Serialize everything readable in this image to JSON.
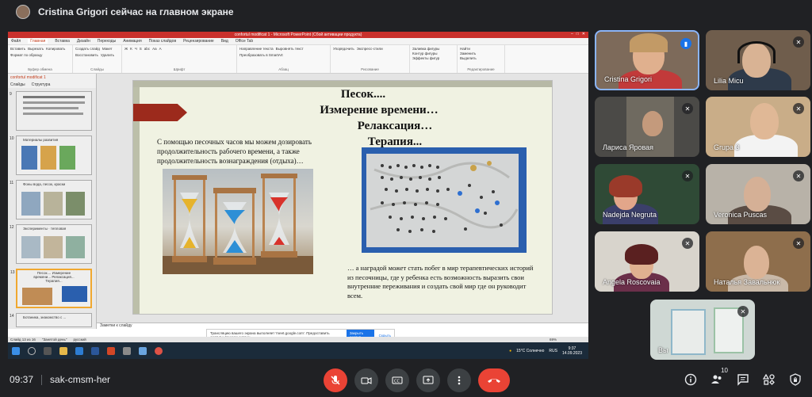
{
  "presenter": {
    "text": "Cristina Grigori сейчас на главном экране"
  },
  "ppt": {
    "window_title": "confortul modificat 1 - Microsoft PowerPoint (Сбой активации продукта)",
    "tabs": [
      "Файл",
      "Главная",
      "Вставка",
      "Дизайн",
      "Переходы",
      "Анимация",
      "Показ слайдов",
      "Рецензирование",
      "Вид",
      "Office Tab"
    ],
    "ribbon_groups": [
      {
        "label": "Буфер обмена",
        "items": [
          "Вставить",
          "Вырезать",
          "Копировать",
          "Формат по образцу"
        ]
      },
      {
        "label": "Слайды",
        "items": [
          "Создать слайд",
          "Макет",
          "Восстановить",
          "Удалить"
        ]
      },
      {
        "label": "Шрифт",
        "items": [
          "Ж",
          "К",
          "Ч",
          "S",
          "abc",
          "Аа",
          "A"
        ]
      },
      {
        "label": "Абзац",
        "items": [
          "Направление текста",
          "Выровнять текст",
          "Преобразовать в SmartArt"
        ]
      },
      {
        "label": "Рисование",
        "items": [
          "Упорядочить",
          "Экспресс-стили"
        ]
      },
      {
        "label": "",
        "items": [
          "Заливка фигуры",
          "Контур фигуры",
          "Эффекты фигур"
        ]
      },
      {
        "label": "Редактирование",
        "items": [
          "Найти",
          "Заменить",
          "Выделить"
        ]
      }
    ],
    "file_tab": "confortul modificat 1",
    "pane_tabs": [
      "Слайды",
      "Структура"
    ],
    "thumbnails": [
      {
        "num": "9",
        "title": ""
      },
      {
        "num": "10",
        "title": "Материалы развития"
      },
      {
        "num": "11",
        "title": "Фоны вода, песок, краски"
      },
      {
        "num": "12",
        "title": "Эксперименты · тепловая"
      },
      {
        "num": "13",
        "title": "Песок.... Измерение времени... Релаксация... Терапия..."
      },
      {
        "num": "14",
        "title": "Ботаника, знакомство с ..."
      }
    ],
    "slide": {
      "title_lines": [
        "Песок....",
        "Измерение времени…",
        "Релаксация… Терапия..."
      ],
      "paragraph1": "С помощью песочных часов мы можем дозировать продолжительность рабочего времени, а также продолжительность вознаграждения  (отдыха)…",
      "paragraph2": "… а наградой может стать побег в мир терапевтических историй из песочницы, где у ребенка есть возможность выразить свои внутренние переживания и создать свой мир где он руководит всем."
    },
    "notes": "Заметки к слайду",
    "status": {
      "slide": "Слайд 13 из 16",
      "theme": "\"Занятой день\"",
      "lang": "русский",
      "zoom": "69%"
    },
    "popup": {
      "text": "Трансляцию вашего экрана выполняет 'meet.google.com'. Предоставить доступ к вашему экрану.",
      "button": "Закрыть доступ",
      "link": "Скрыть"
    },
    "taskbar": {
      "weather": "15°C Солнечно",
      "lang": "RUS",
      "time": "9:37",
      "date": "14.09.2023"
    }
  },
  "participants": [
    {
      "name": "Cristina Grigori",
      "mic": "active"
    },
    {
      "name": "Lilia Micu",
      "mic": "off"
    },
    {
      "name": "Лариса Яровая",
      "mic": "off"
    },
    {
      "name": "Grupa 3",
      "mic": "off"
    },
    {
      "name": "Nadejda Negruta",
      "mic": "off"
    },
    {
      "name": "Veronica Puscas",
      "mic": "off"
    },
    {
      "name": "Angela Roscovaia",
      "mic": "off"
    },
    {
      "name": "Наталья Завальнюк",
      "mic": "off"
    },
    {
      "name": "Вы",
      "mic": "off"
    }
  ],
  "bottom": {
    "time": "09:37",
    "meeting_code": "sak-cmsm-her",
    "people_count": "10"
  },
  "colors": {
    "background": "#202124",
    "end_call": "#ea4335",
    "mic_active": "#1a73e8",
    "ppt_accent": "#c9302c"
  }
}
